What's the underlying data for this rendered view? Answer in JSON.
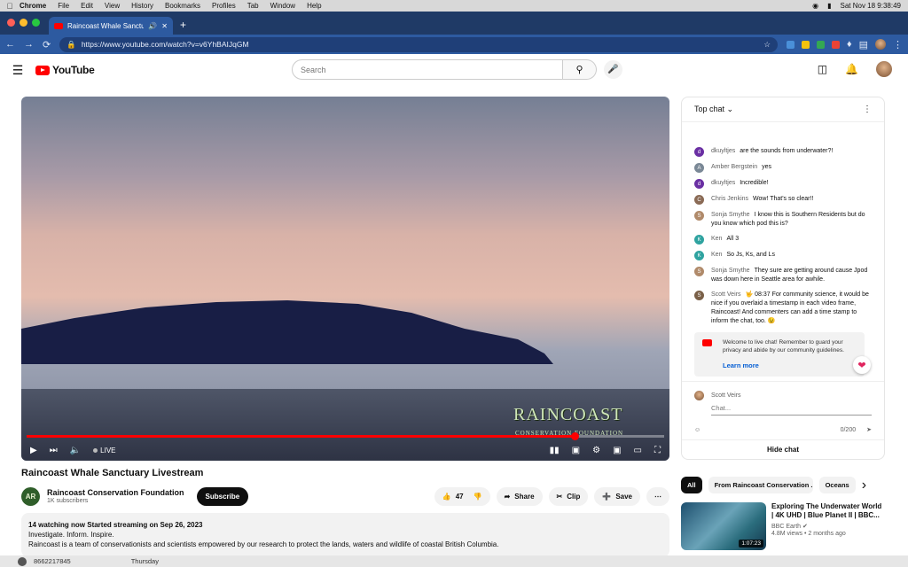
{
  "mac": {
    "app": "Chrome",
    "menus": [
      "File",
      "Edit",
      "View",
      "History",
      "Bookmarks",
      "Profiles",
      "Tab",
      "Window",
      "Help"
    ],
    "clock": "Sat Nov 18  9:38:49"
  },
  "browser": {
    "tab_title": "Raincoast Whale Sanctuary",
    "url": "https://www.youtube.com/watch?v=v6YhBAIJqGM",
    "new_tab": "+"
  },
  "header": {
    "logo": "YouTube",
    "search_placeholder": "Search"
  },
  "player": {
    "live_label": "LIVE",
    "watermark": "RAINCOAST",
    "watermark_sub": "CONSERVATION FOUNDATION",
    "progress": 0.86
  },
  "chat": {
    "mode": "Top chat",
    "messages": [
      {
        "author": "dkuyltjes",
        "text": "are the sounds from underwater?!",
        "initial": "d",
        "color": "#6a2fa3"
      },
      {
        "author": "Amber Bergstein",
        "text": "yes",
        "initial": "A",
        "color": "#7a8896"
      },
      {
        "author": "dkuyltjes",
        "text": "Incredible!",
        "initial": "d",
        "color": "#6a2fa3"
      },
      {
        "author": "Chris Jenkins",
        "text": "Wow! That's so clear!!",
        "initial": "C",
        "color": "#8a6a55"
      },
      {
        "author": "Sonja Smythe",
        "text": "I know this is Southern Residents but do you know which pod this is?",
        "initial": "S",
        "color": "#b08a6a"
      },
      {
        "author": "Ken",
        "text": "All 3",
        "initial": "K",
        "color": "#2fa3a0"
      },
      {
        "author": "Ken",
        "text": "So Js, Ks, and Ls",
        "initial": "K",
        "color": "#2fa3a0"
      },
      {
        "author": "Sonja Smythe",
        "text": "They sure are getting around cause Jpod was down here in Seattle area for awhile.",
        "initial": "S",
        "color": "#b08a6a"
      },
      {
        "author": "Scott Veirs",
        "text": "🤟 08:37 For community science, it would be nice if you overlaid a timestamp in each video frame, Raincoast! And commenters can add a time stamp to inform the chat, too. 😉",
        "initial": "S",
        "color": "#7a6048"
      }
    ],
    "welcome_text": "Welcome to live chat! Remember to guard your privacy and abide by our community guidelines.",
    "learn_more": "Learn more",
    "user": "Scott Veirs",
    "placeholder": "Chat...",
    "counter": "0/200",
    "hide": "Hide chat"
  },
  "video": {
    "title": "Raincoast Whale Sanctuary Livestream",
    "channel": "Raincoast Conservation Foundation",
    "channel_initials": "AR",
    "subscribers": "1K subscribers",
    "subscribe": "Subscribe",
    "likes": "47",
    "share": "Share",
    "clip": "Clip",
    "save": "Save",
    "meta": "14 watching now  Started streaming on Sep 26, 2023",
    "desc_line1": "Investigate. Inform. Inspire.",
    "desc_line2": "Raincoast is a team of conservationists and scientists empowered by our research to protect the lands, waters and wildlife of coastal British Columbia."
  },
  "chips": [
    "All",
    "From Raincoast Conservation ...",
    "Oceans"
  ],
  "recommended": {
    "title": "Exploring The Underwater World | 4K UHD | Blue Planet II | BBC...",
    "channel": "BBC Earth",
    "stats": "4.8M views • 2 months ago",
    "duration": "1:07:23"
  },
  "dock": {
    "number": "8662217845",
    "day": "Thursday"
  }
}
